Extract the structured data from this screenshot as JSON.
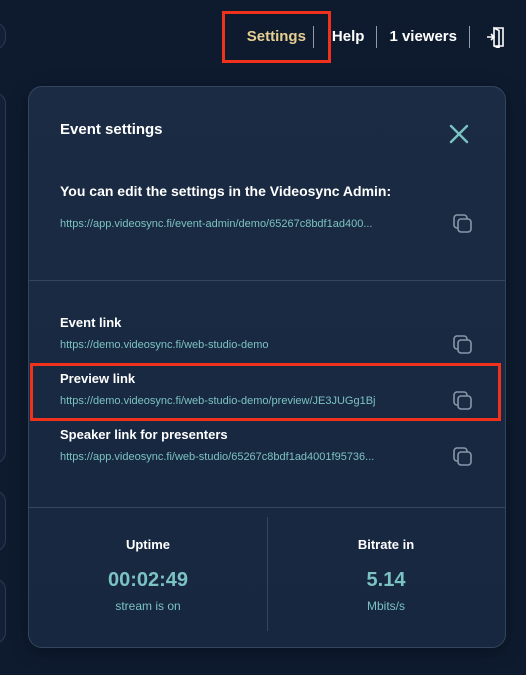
{
  "nav": {
    "settings_label": "Settings",
    "help_label": "Help",
    "viewers_label": "1 viewers",
    "exit_icon": "exit-door-icon"
  },
  "panel": {
    "title": "Event settings",
    "close_icon": "close-icon",
    "admin_text": "You can edit the settings in the Videosync Admin:",
    "admin_link": "https://app.videosync.fi/event-admin/demo/65267c8bdf1ad400...",
    "links": [
      {
        "label": "Event link",
        "url": "https://demo.videosync.fi/web-studio-demo"
      },
      {
        "label": "Preview link",
        "url": "https://demo.videosync.fi/web-studio-demo/preview/JE3JUGg1Bj"
      },
      {
        "label": "Speaker link for presenters",
        "url": "https://app.videosync.fi/web-studio/65267c8bdf1ad4001f95736..."
      }
    ],
    "copy_icon": "copy-icon"
  },
  "stats": {
    "uptime": {
      "label": "Uptime",
      "value": "00:02:49",
      "sub": "stream is on"
    },
    "bitrate": {
      "label": "Bitrate in",
      "value": "5.14",
      "sub": "Mbits/s"
    }
  },
  "colors": {
    "background": "#0e1b2f",
    "panel": "#1b2b43",
    "accent": "#7bc2c2",
    "settings_text": "#e7cf91",
    "highlight": "#f0321c"
  }
}
